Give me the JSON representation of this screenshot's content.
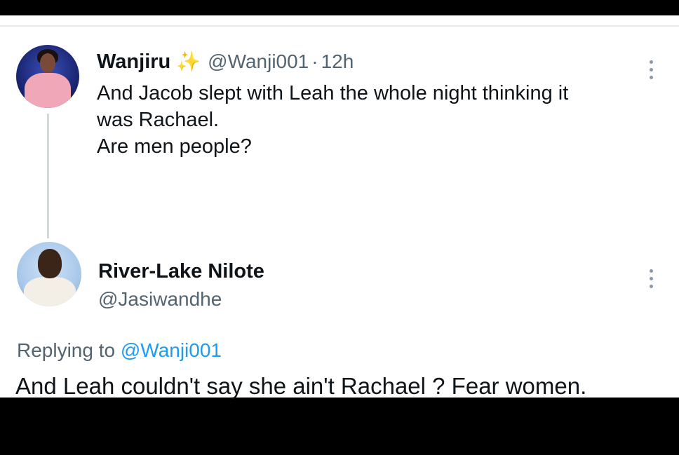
{
  "tweet": {
    "author_name": "Wanjiru",
    "author_emoji": "✨",
    "author_handle": "@Wanji001",
    "separator": "·",
    "time": "12h",
    "lines": [
      "And Jacob slept with Leah the whole night thinking it",
      "was Rachael.",
      "Are men people?"
    ]
  },
  "reply": {
    "author_name": "River-Lake Nilote",
    "author_handle": "@Jasiwandhe",
    "replying_prefix": "Replying to",
    "replying_mention": "@Wanji001",
    "text": "And Leah couldn't say she ain't Rachael ? Fear women."
  },
  "colors": {
    "link": "#1d9bf0",
    "secondary_text": "#536471",
    "primary_text": "#0f1419",
    "thread_line": "#cfd9de"
  }
}
